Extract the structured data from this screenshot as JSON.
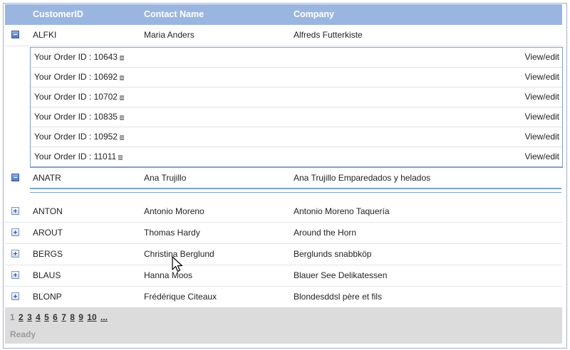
{
  "grid": {
    "columns": [
      "CustomerID",
      "Contact Name",
      "Company"
    ],
    "rows": [
      {
        "id": "ALFKI",
        "contact": "Maria Anders",
        "company": "Alfreds Futterkiste",
        "expanded": true
      },
      {
        "id": "ANATR",
        "contact": "Ana Trujillo",
        "company": "Ana Trujillo Emparedados y helados",
        "expanded": true
      },
      {
        "id": "ANTON",
        "contact": "Antonio Moreno",
        "company": "Antonio Moreno Taquería",
        "expanded": false
      },
      {
        "id": "AROUT",
        "contact": "Thomas Hardy",
        "company": "Around the Horn",
        "expanded": false
      },
      {
        "id": "BERGS",
        "contact": "Christina Berglund",
        "company": "Berglunds snabbköp",
        "expanded": false
      },
      {
        "id": "BLAUS",
        "contact": "Hanna Moos",
        "company": "Blauer See Delikatessen",
        "expanded": false
      },
      {
        "id": "BLONP",
        "contact": "Frédérique Citeaux",
        "company": "Blondesddsl père et fils",
        "expanded": false
      }
    ],
    "orders": [
      {
        "label": "Your Order ID : 10643",
        "action": "View/edit"
      },
      {
        "label": "Your Order ID : 10692",
        "action": "View/edit"
      },
      {
        "label": "Your Order ID : 10702",
        "action": "View/edit"
      },
      {
        "label": "Your Order ID : 10835",
        "action": "View/edit"
      },
      {
        "label": "Your Order ID : 10952",
        "action": "View/edit"
      },
      {
        "label": "Your Order ID : 11011",
        "action": "View/edit"
      }
    ]
  },
  "pager": {
    "pages": [
      "1",
      "2",
      "3",
      "4",
      "5",
      "6",
      "7",
      "8",
      "9",
      "10",
      "..."
    ],
    "current": "1"
  },
  "status": "Ready",
  "colors": {
    "header": "#9ab6e0",
    "detail_border": "#7fa0cc",
    "pager": "#dcdcdc"
  }
}
